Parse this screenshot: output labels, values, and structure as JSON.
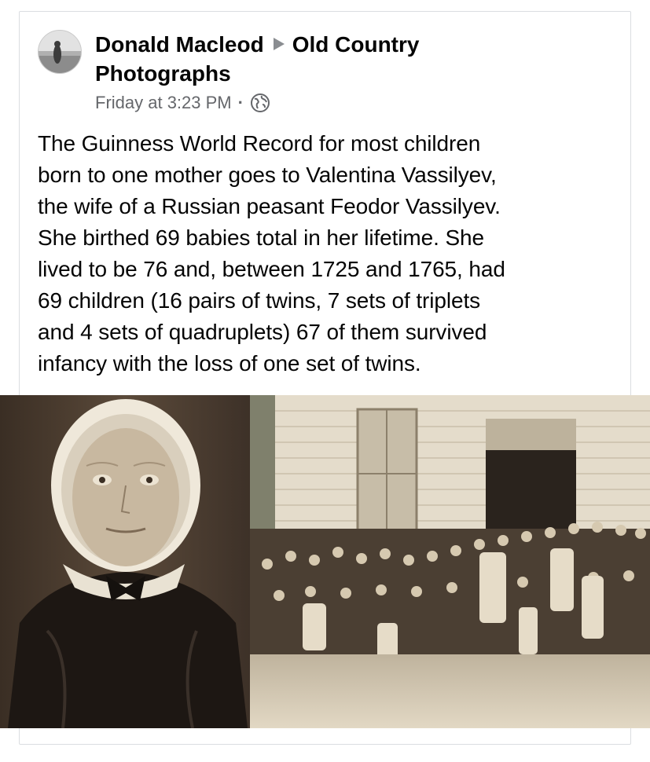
{
  "post": {
    "author": "Donald Macleod",
    "group_line1": "Old Country",
    "group_line2": "Photographs",
    "timestamp": "Friday at 3:23 PM",
    "separator": "·",
    "privacy_icon": "globe-icon",
    "text_lines": [
      "The Guinness World Record for most children",
      "born to one mother goes to Valentina Vassilyev,",
      "the wife of a Russian peasant Feodor Vassilyev.",
      "She birthed 69 babies total in her lifetime. She",
      "lived to be 76 and, between 1725 and 1765, had",
      "69 children (16 pairs of twins, 7 sets of triplets",
      "and 4 sets of quadruplets) 67 of them survived",
      "infancy with the loss of one set of twins."
    ]
  },
  "colors": {
    "author_text": "#050505",
    "meta_text": "#65676b",
    "card_border": "#dadde1",
    "sepia_dark": "#3b2f24",
    "sepia_light": "#d9ccb3"
  }
}
